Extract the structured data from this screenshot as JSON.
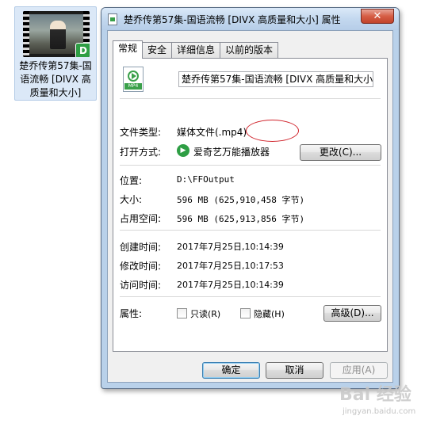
{
  "desktop_icon": {
    "label": "楚乔传第57集-国语流畅 [DIVX 高质量和大小]",
    "badge": "D"
  },
  "dialog": {
    "title": "楚乔传第57集-国语流畅 [DIVX 高质量和大小] 属性",
    "close_label": "✕",
    "tabs": [
      "常规",
      "安全",
      "详细信息",
      "以前的版本"
    ],
    "file_icon_tag": "MP4",
    "file_name": "楚乔传第57集-国语流畅 [DIVX 高质量和大小]",
    "file_type_label": "文件类型:",
    "file_type_value": "媒体文件(.mp4)",
    "file_type_ext": "(.mp4)",
    "open_with_label": "打开方式:",
    "open_with_value": "爱奇艺万能播放器",
    "change_button": "更改(C)...",
    "location_label": "位置:",
    "location_value": "D:\\FFOutput",
    "size_label": "大小:",
    "size_value": "596 MB (625,910,458 字节)",
    "disk_size_label": "占用空间:",
    "disk_size_value": "596 MB (625,913,856 字节)",
    "created_label": "创建时间:",
    "created_value": "2017年7月25日,10:14:39",
    "modified_label": "修改时间:",
    "modified_value": "2017年7月25日,10:17:53",
    "accessed_label": "访问时间:",
    "accessed_value": "2017年7月25日,10:14:39",
    "attributes_label": "属性:",
    "readonly_label": "只读(R)",
    "hidden_label": "隐藏(H)",
    "advanced_button": "高级(D)...",
    "ok_button": "确定",
    "cancel_button": "取消",
    "apply_button": "应用(A)"
  },
  "watermark": {
    "text": "Bai 经验",
    "sub": "jingyan.baidu.com"
  },
  "colors": {
    "accent_green": "#2e9e44",
    "annotation_red": "#d0222a",
    "window_frame": "#b9d1ea"
  }
}
